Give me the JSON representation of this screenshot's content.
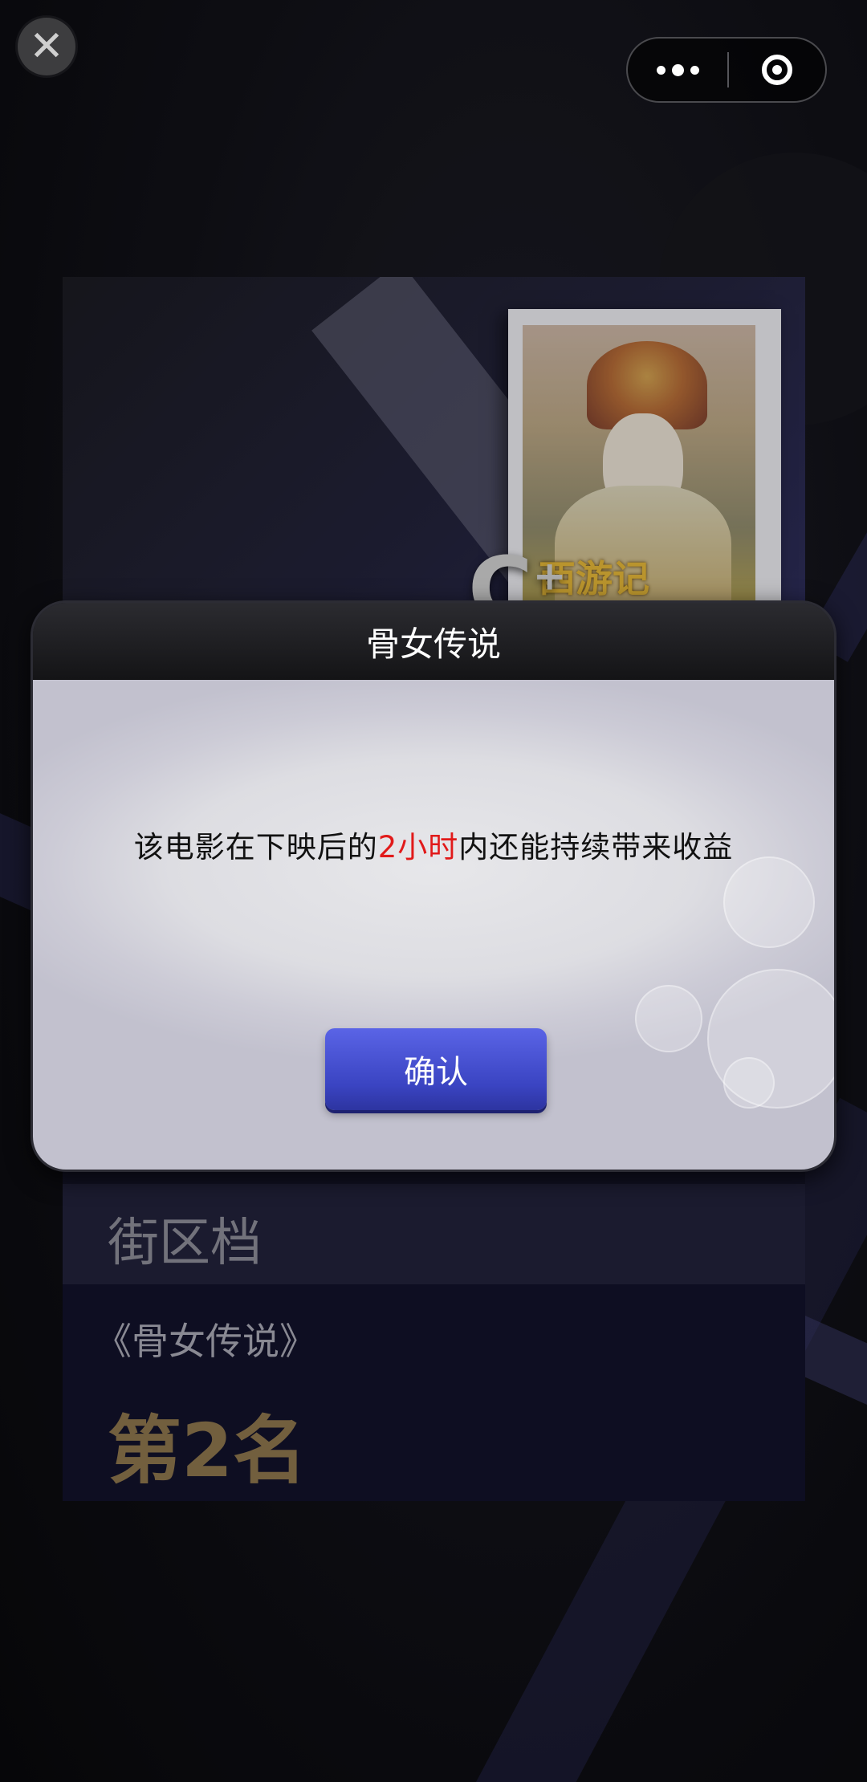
{
  "top_bar": {
    "close_icon": "close-icon",
    "more_icon": "more-dots-icon",
    "exit_icon": "circle-target-icon"
  },
  "poster": {
    "title_logo_text": "西游记",
    "grade_text": "C",
    "grade_suffix": "+"
  },
  "card": {
    "district_label": "街区档",
    "movie_name": "《骨女传说》",
    "rank": "第2名"
  },
  "modal": {
    "title": "骨女传说",
    "message_before": "该电影在下映后的",
    "message_highlight": "2小时",
    "message_after": "内还能持续带来收益",
    "confirm_label": "确认",
    "highlight_color": "#e11a1a",
    "button_color": "#4a52d6"
  }
}
